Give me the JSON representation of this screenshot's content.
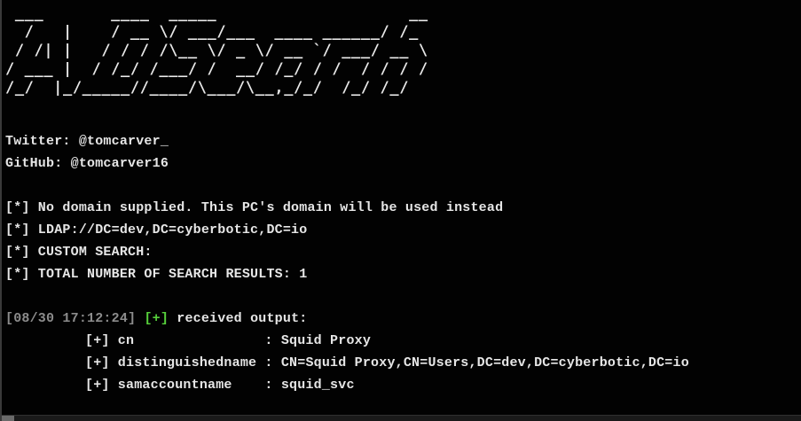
{
  "terminal": {
    "banner": " ___       ____  _____                    __\n  /   |    / __ \\/ ___/___  ____ ______/ /_\n / /| |   / / / /\\__ \\/ _ \\/ __ `/ ___/ __ \\\n/ ___ |  / /_/ /___/ /  __/ /_/ / /  / / / /\n/_/  |_/_____//____/\\___/\\__,_/_/  /_/ /_/",
    "twitter": "Twitter: @tomcarver_",
    "github": "GitHub: @tomcarver16",
    "info_lines": [
      "[*] No domain supplied. This PC's domain will be used instead",
      "[*] LDAP://DC=dev,DC=cyberbotic,DC=io",
      "[*] CUSTOM SEARCH:",
      "[*] TOTAL NUMBER OF SEARCH RESULTS: 1"
    ],
    "output_header": {
      "timestamp": "[08/30 17:12:24]",
      "marker": "[+]",
      "text": "received output:"
    },
    "results": [
      "[+] cn                : Squid Proxy",
      "[+] distinguishedname : CN=Squid Proxy,CN=Users,DC=dev,DC=cyberbotic,DC=io",
      "[+] samaccountname    : squid_svc"
    ]
  },
  "colors": {
    "background": "#020202",
    "text": "#e6e6e6",
    "timestamp": "#8c8c8c",
    "success_marker": "#57d13c"
  }
}
